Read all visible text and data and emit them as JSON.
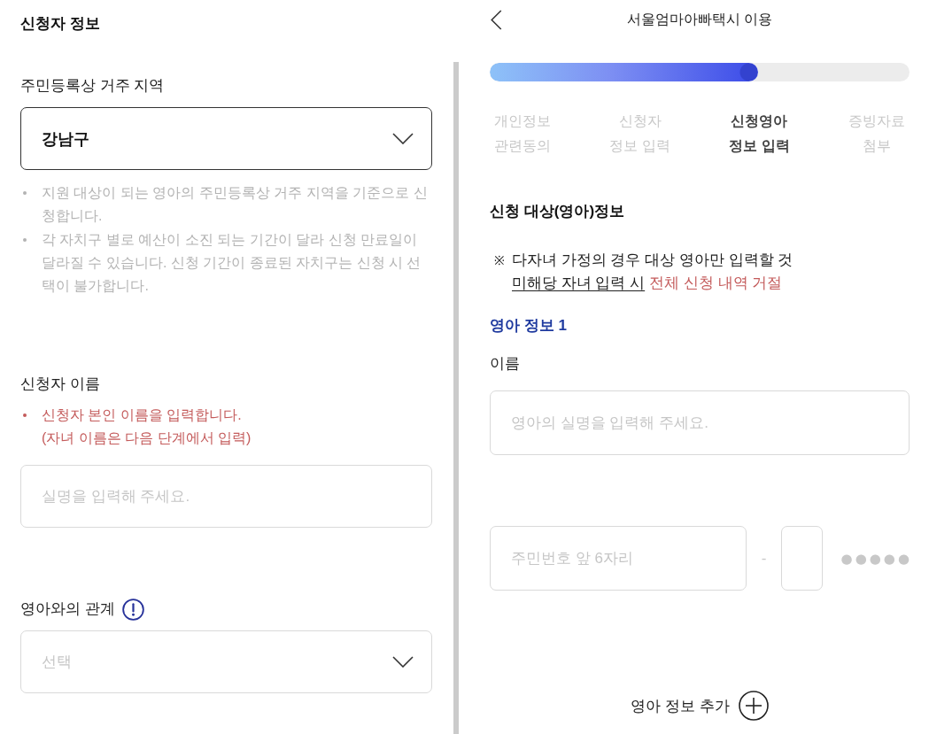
{
  "applicant_panel": {
    "blocks": [
      {
        "kind": "heading",
        "text": "신청자 정보"
      },
      {
        "kind": "label",
        "text": "주민등록상 거주 지역",
        "info": false
      },
      {
        "kind": "select",
        "value": "강남구"
      },
      {
        "kind": "hints",
        "items": [
          "지원 대상이 되는 영아의 주민등록상 거주 지역을 기준으로 신청합니다.",
          "각 자치구 별로 예산이 소진 되는 기간이 달라 신청 만료일이 달라질 수 있습니다. 신청 기간이 종료된 자치구는 신청 시 선택이 불가합니다."
        ]
      },
      {
        "kind": "label",
        "text": "신청자 이름",
        "info": false
      },
      {
        "kind": "warnings",
        "items": [
          "신청자 본인 이름을 입력합니다.\n(자녀 이름은 다음 단계에서 입력)"
        ]
      },
      {
        "kind": "input",
        "placeholder": "실명을 입력해 주세요."
      },
      {
        "kind": "label",
        "text": "영아와의 관계",
        "info": true
      },
      {
        "kind": "select",
        "placeholder": "선택"
      }
    ]
  },
  "child_panel": {
    "header": {
      "title": "서울엄마아빠택시 이용"
    },
    "progress": {
      "level": 0.64
    },
    "steps": [
      {
        "label": "개인정보\n관련동의",
        "selected": false
      },
      {
        "label": "신청자\n정보 입력",
        "selected": false
      },
      {
        "label": "신청영아\n정보 입력",
        "selected": true
      },
      {
        "label": "증빙자료\n첨부",
        "selected": false
      }
    ],
    "section_title": "신청 대상(영아)정보",
    "notice": {
      "mark": "※",
      "text": "다자녀 가정의 경우 대상 영아만 입력할 것",
      "underlined": "미해당 자녀 입력 시",
      "alert": "전체 신청 내역 거절"
    },
    "child_title": "영아 정보 1",
    "name_label": "이름",
    "name_placeholder": "영아의 실명을 입력해 주세요.",
    "id_number": {
      "placeholder": "주민번호 앞 6자리",
      "separator": "-",
      "masked": "●●●●●"
    },
    "add_button": "영아 정보 추가"
  }
}
